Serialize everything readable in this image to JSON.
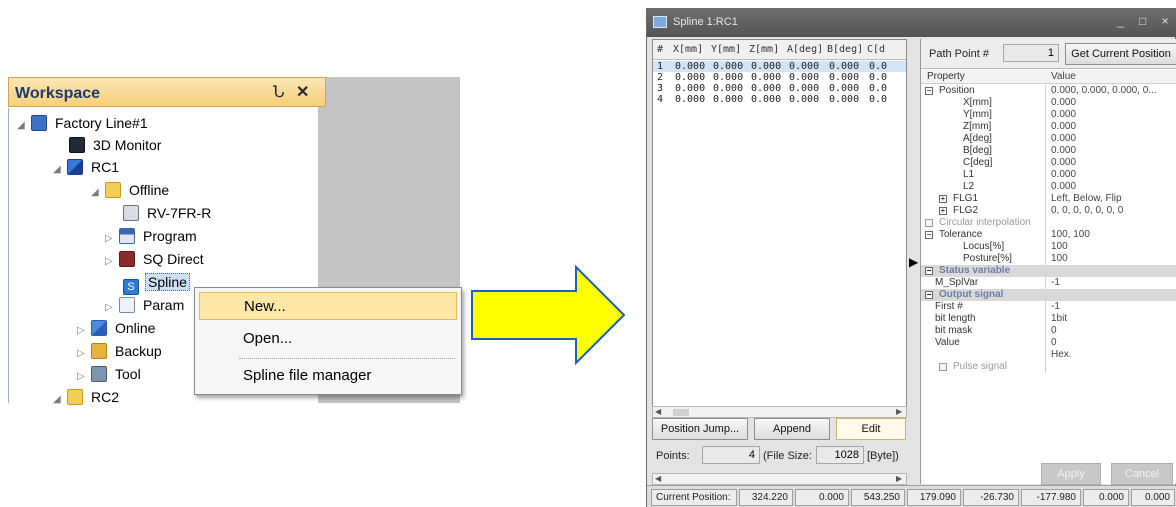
{
  "workspace": {
    "title": "Workspace",
    "pin_glyph": "Ն",
    "close_glyph": "✕",
    "tree": [
      {
        "label": "Factory Line#1",
        "icon": "factory-icon"
      },
      {
        "label": "3D Monitor",
        "icon": "monitor-icon"
      },
      {
        "label": "RC1",
        "icon": "robot-controller-icon"
      },
      {
        "label": "Offline",
        "icon": "folder-icon"
      },
      {
        "label": "RV-7FR-R",
        "icon": "robot-model-icon"
      },
      {
        "label": "Program",
        "icon": "program-icon"
      },
      {
        "label": "SQ Direct",
        "icon": "sq-direct-icon"
      },
      {
        "label": "Spline",
        "icon": "spline-icon"
      },
      {
        "label": "Param",
        "icon": "parameter-icon"
      },
      {
        "label": "Online",
        "icon": "online-icon"
      },
      {
        "label": "Backup",
        "icon": "backup-icon"
      },
      {
        "label": "Tool",
        "icon": "tool-icon"
      },
      {
        "label": "RC2",
        "icon": "folder-icon"
      }
    ],
    "context_menu": {
      "items": [
        "New...",
        "Open...",
        "Spline file manager"
      ]
    }
  },
  "spline_window": {
    "title": "Spline 1:RC1",
    "controls": "_ □ ×",
    "table": {
      "headers": [
        "#",
        "X[mm]",
        "Y[mm]",
        "Z[mm]",
        "A[deg]",
        "B[deg]",
        "C[d"
      ],
      "rows": [
        [
          "1",
          "0.000",
          "0.000",
          "0.000",
          "0.000",
          "0.000",
          "0.0"
        ],
        [
          "2",
          "0.000",
          "0.000",
          "0.000",
          "0.000",
          "0.000",
          "0.0"
        ],
        [
          "3",
          "0.000",
          "0.000",
          "0.000",
          "0.000",
          "0.000",
          "0.0"
        ],
        [
          "4",
          "0.000",
          "0.000",
          "0.000",
          "0.000",
          "0.000",
          "0.0"
        ]
      ]
    },
    "buttons": {
      "position_jump": "Position Jump...",
      "append": "Append",
      "edit": "Edit",
      "get_current_position": "Get Current Position",
      "apply": "Apply",
      "cancel": "Cancel"
    },
    "points": {
      "label": "Points:",
      "value": "4",
      "file_size_label": "(File Size:",
      "file_size_value": "1028",
      "unit": "[Byte])"
    },
    "path_point": {
      "label": "Path Point #",
      "value": "1"
    },
    "properties": {
      "header_property": "Property",
      "header_value": "Value",
      "rows": [
        {
          "key": "Position",
          "value": "0.000, 0.000, 0.000, 0...",
          "indent": 0,
          "box": "−",
          "kind": "group"
        },
        {
          "key": "X[mm]",
          "value": "0.000",
          "indent": 2,
          "kind": "row"
        },
        {
          "key": "Y[mm]",
          "value": "0.000",
          "indent": 2,
          "kind": "row"
        },
        {
          "key": "Z[mm]",
          "value": "0.000",
          "indent": 2,
          "kind": "row"
        },
        {
          "key": "A[deg]",
          "value": "0.000",
          "indent": 2,
          "kind": "row"
        },
        {
          "key": "B[deg]",
          "value": "0.000",
          "indent": 2,
          "kind": "row"
        },
        {
          "key": "C[deg]",
          "value": "0.000",
          "indent": 2,
          "kind": "row"
        },
        {
          "key": "L1",
          "value": "0.000",
          "indent": 2,
          "kind": "row"
        },
        {
          "key": "L2",
          "value": "0.000",
          "indent": 2,
          "kind": "row"
        },
        {
          "key": "FLG1",
          "value": "Left, Below, Flip",
          "indent": 1,
          "box": "+",
          "kind": "group"
        },
        {
          "key": "FLG2",
          "value": "0, 0, 0, 0, 0, 0, 0",
          "indent": 1,
          "box": "+",
          "kind": "group"
        },
        {
          "key": "Circular interpolation",
          "value": "",
          "indent": 0,
          "kind": "check"
        },
        {
          "key": "Tolerance",
          "value": "100, 100",
          "indent": 0,
          "box": "−",
          "kind": "group"
        },
        {
          "key": "Locus[%]",
          "value": "100",
          "indent": 2,
          "kind": "row"
        },
        {
          "key": "Posture[%]",
          "value": "100",
          "indent": 2,
          "kind": "row"
        },
        {
          "key": "Status variable",
          "value": "",
          "indent": 0,
          "box": "−",
          "kind": "category"
        },
        {
          "key": "M_SplVar",
          "value": "-1",
          "indent": 0,
          "kind": "row"
        },
        {
          "key": "Output signal",
          "value": "",
          "indent": 0,
          "box": "−",
          "kind": "category"
        },
        {
          "key": "First #",
          "value": "-1",
          "indent": 0,
          "kind": "row"
        },
        {
          "key": "bit length",
          "value": "1bit",
          "indent": 0,
          "kind": "row"
        },
        {
          "key": "bit mask",
          "value": "0",
          "indent": 0,
          "kind": "row"
        },
        {
          "key": "Value",
          "value": "0",
          "indent": 0,
          "kind": "row"
        },
        {
          "key": "",
          "value": "Hex.",
          "indent": 0,
          "kind": "row"
        },
        {
          "key": "Pulse signal",
          "value": "",
          "indent": 1,
          "kind": "check"
        }
      ]
    },
    "current_position": {
      "label": "Current Position:",
      "values": [
        "324.220",
        "0.000",
        "543.250",
        "179.090",
        "-26.730",
        "-177.980",
        "0.000",
        "0.000"
      ]
    }
  }
}
